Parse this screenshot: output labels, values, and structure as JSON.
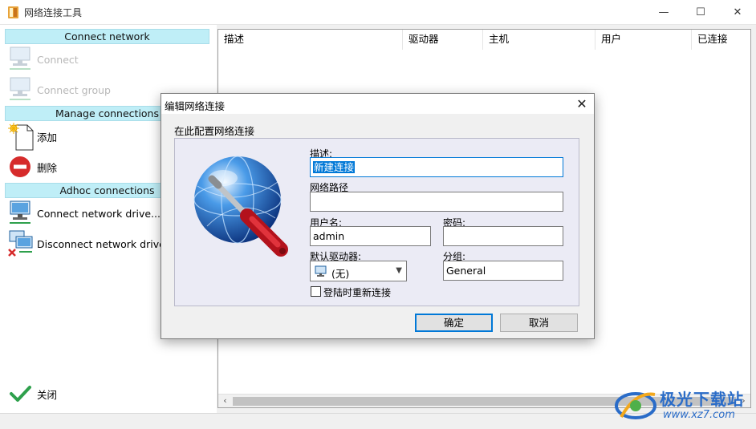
{
  "window": {
    "title": "网络连接工具",
    "minimize_glyph": "—",
    "maximize_glyph": "☐",
    "close_glyph": "✕"
  },
  "left_panel": {
    "sections": [
      {
        "header": "Connect network",
        "items": [
          {
            "label": "Connect",
            "icon": "network-computer-icon",
            "enabled": false
          },
          {
            "label": "Connect group",
            "icon": "network-group-icon",
            "enabled": false
          }
        ]
      },
      {
        "header": "Manage connections",
        "items": [
          {
            "label": "添加",
            "icon": "new-document-icon",
            "enabled": true
          },
          {
            "label": "删除",
            "icon": "delete-icon",
            "enabled": true
          }
        ]
      },
      {
        "header": "Adhoc connections",
        "items": [
          {
            "label": "Connect network drive...",
            "icon": "connect-drive-icon",
            "enabled": true
          },
          {
            "label": "Disconnect network drive...",
            "icon": "disconnect-drive-icon",
            "enabled": true
          }
        ]
      }
    ],
    "close_label": "关闭"
  },
  "table": {
    "columns": [
      "描述",
      "驱动器",
      "主机",
      "用户",
      "已连接"
    ],
    "rows": []
  },
  "dialog": {
    "title": "编辑网络连接",
    "subtitle": "在此配置网络连接",
    "fields": {
      "description_label": "描述:",
      "description_value": "新建连接",
      "path_label": "网络路径",
      "path_value": "",
      "username_label": "用户名:",
      "username_value": "admin",
      "password_label": "密码:",
      "password_value": "",
      "drive_label": "默认驱动器:",
      "drive_value": "(无)",
      "group_label": "分组:",
      "group_value": "General",
      "reconnect_label": "登陆时重新连接",
      "reconnect_checked": false
    },
    "ok_label": "确定",
    "cancel_label": "取消"
  },
  "watermark": {
    "title": "极光下载站",
    "url": "www.xz7.com"
  },
  "colors": {
    "section_header_bg": "#bfeef7",
    "accent": "#0078d7",
    "dialog_box_bg": "#ebebf5"
  }
}
